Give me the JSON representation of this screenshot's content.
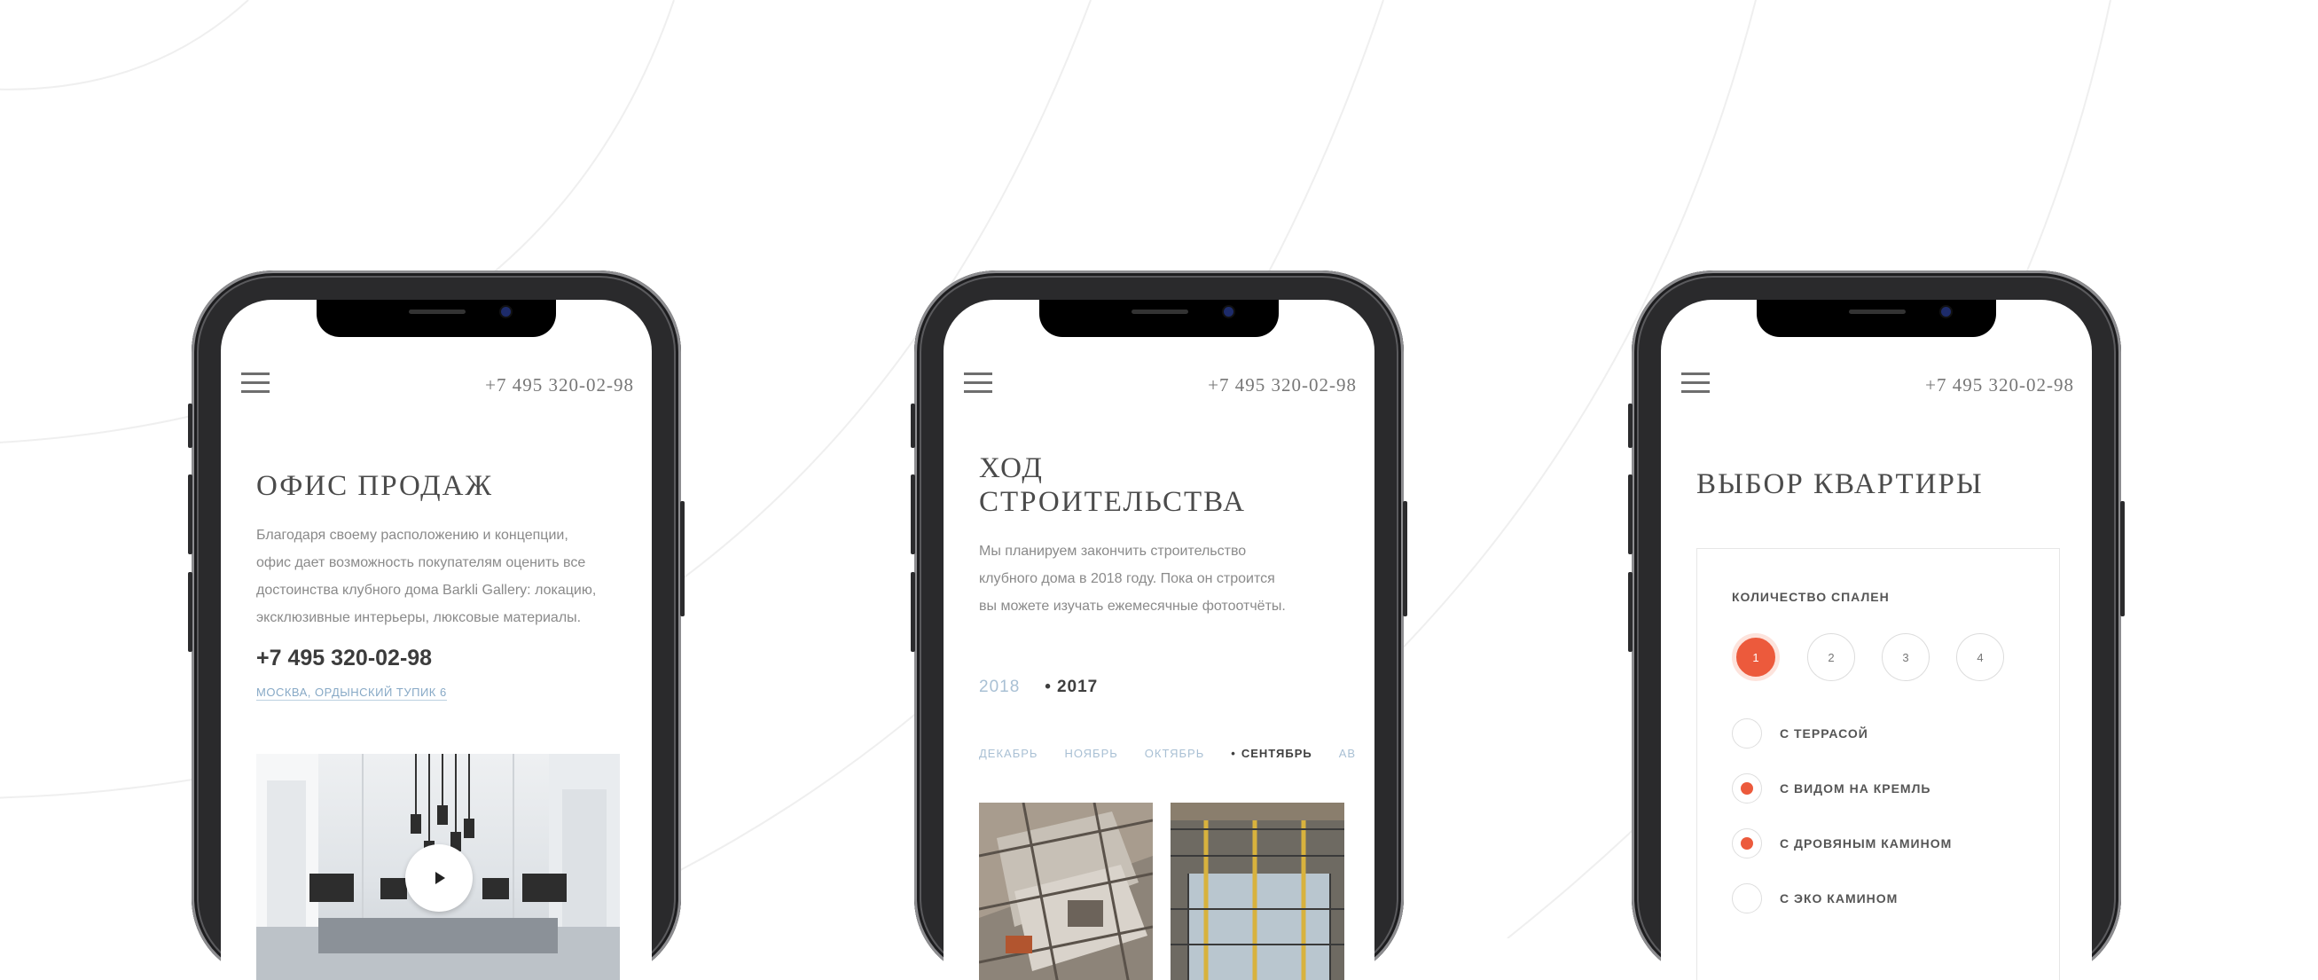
{
  "screens": [
    {
      "header": {
        "phone": "+7 495 320-02-98"
      },
      "title": "ОФИС ПРОДАЖ",
      "description": [
        "Благодаря своему расположению и концепции,",
        "офис дает возможность покупателям оценить все",
        "достоинства клубного дома Barkli Gallery: локацию,",
        "эксклюзивные интерьеры, люксовые материалы."
      ],
      "phone": "+7 495 320-02-98",
      "address": "МОСКВА, ОРДЫНСКИЙ ТУПИК 6"
    },
    {
      "header": {
        "phone": "+7 495 320-02-98"
      },
      "title": [
        "ХОД",
        "СТРОИТЕЛЬСТВА"
      ],
      "description": [
        "Мы планируем закончить строительство",
        "клубного дома в 2018 году. Пока он строится",
        "вы можете изучать ежемесячные фотоотчёты."
      ],
      "years": [
        {
          "label": "2018",
          "active": false
        },
        {
          "label": "2017",
          "active": true
        }
      ],
      "active_dot": "•",
      "months": [
        {
          "label": "ДЕКАБРЬ",
          "active": false
        },
        {
          "label": "НОЯБРЬ",
          "active": false
        },
        {
          "label": "ОКТЯБРЬ",
          "active": false
        },
        {
          "label": "СЕНТЯБРЬ",
          "active": true
        },
        {
          "label": "АВ",
          "active": false
        }
      ]
    },
    {
      "header": {
        "phone": "+7 495 320-02-98"
      },
      "title": "ВЫБОР КВАРТИРЫ",
      "bedrooms_label": "КОЛИЧЕСТВО СПАЛЕН",
      "bedrooms": [
        {
          "label": "1",
          "active": true
        },
        {
          "label": "2",
          "active": false
        },
        {
          "label": "3",
          "active": false
        },
        {
          "label": "4",
          "active": false
        }
      ],
      "options": [
        {
          "label": "С ТЕРРАСОЙ",
          "checked": false
        },
        {
          "label": "С ВИДОМ НА КРЕМЛЬ",
          "checked": true
        },
        {
          "label": "С ДРОВЯНЫМ КАМИНОМ",
          "checked": true
        },
        {
          "label": "С ЭКО КАМИНОМ",
          "checked": false
        }
      ]
    }
  ],
  "colors": {
    "accent": "#ec5a3c",
    "link": "#87a9c6",
    "muted": "#a9c0d4",
    "text": "#4b4b4b"
  }
}
